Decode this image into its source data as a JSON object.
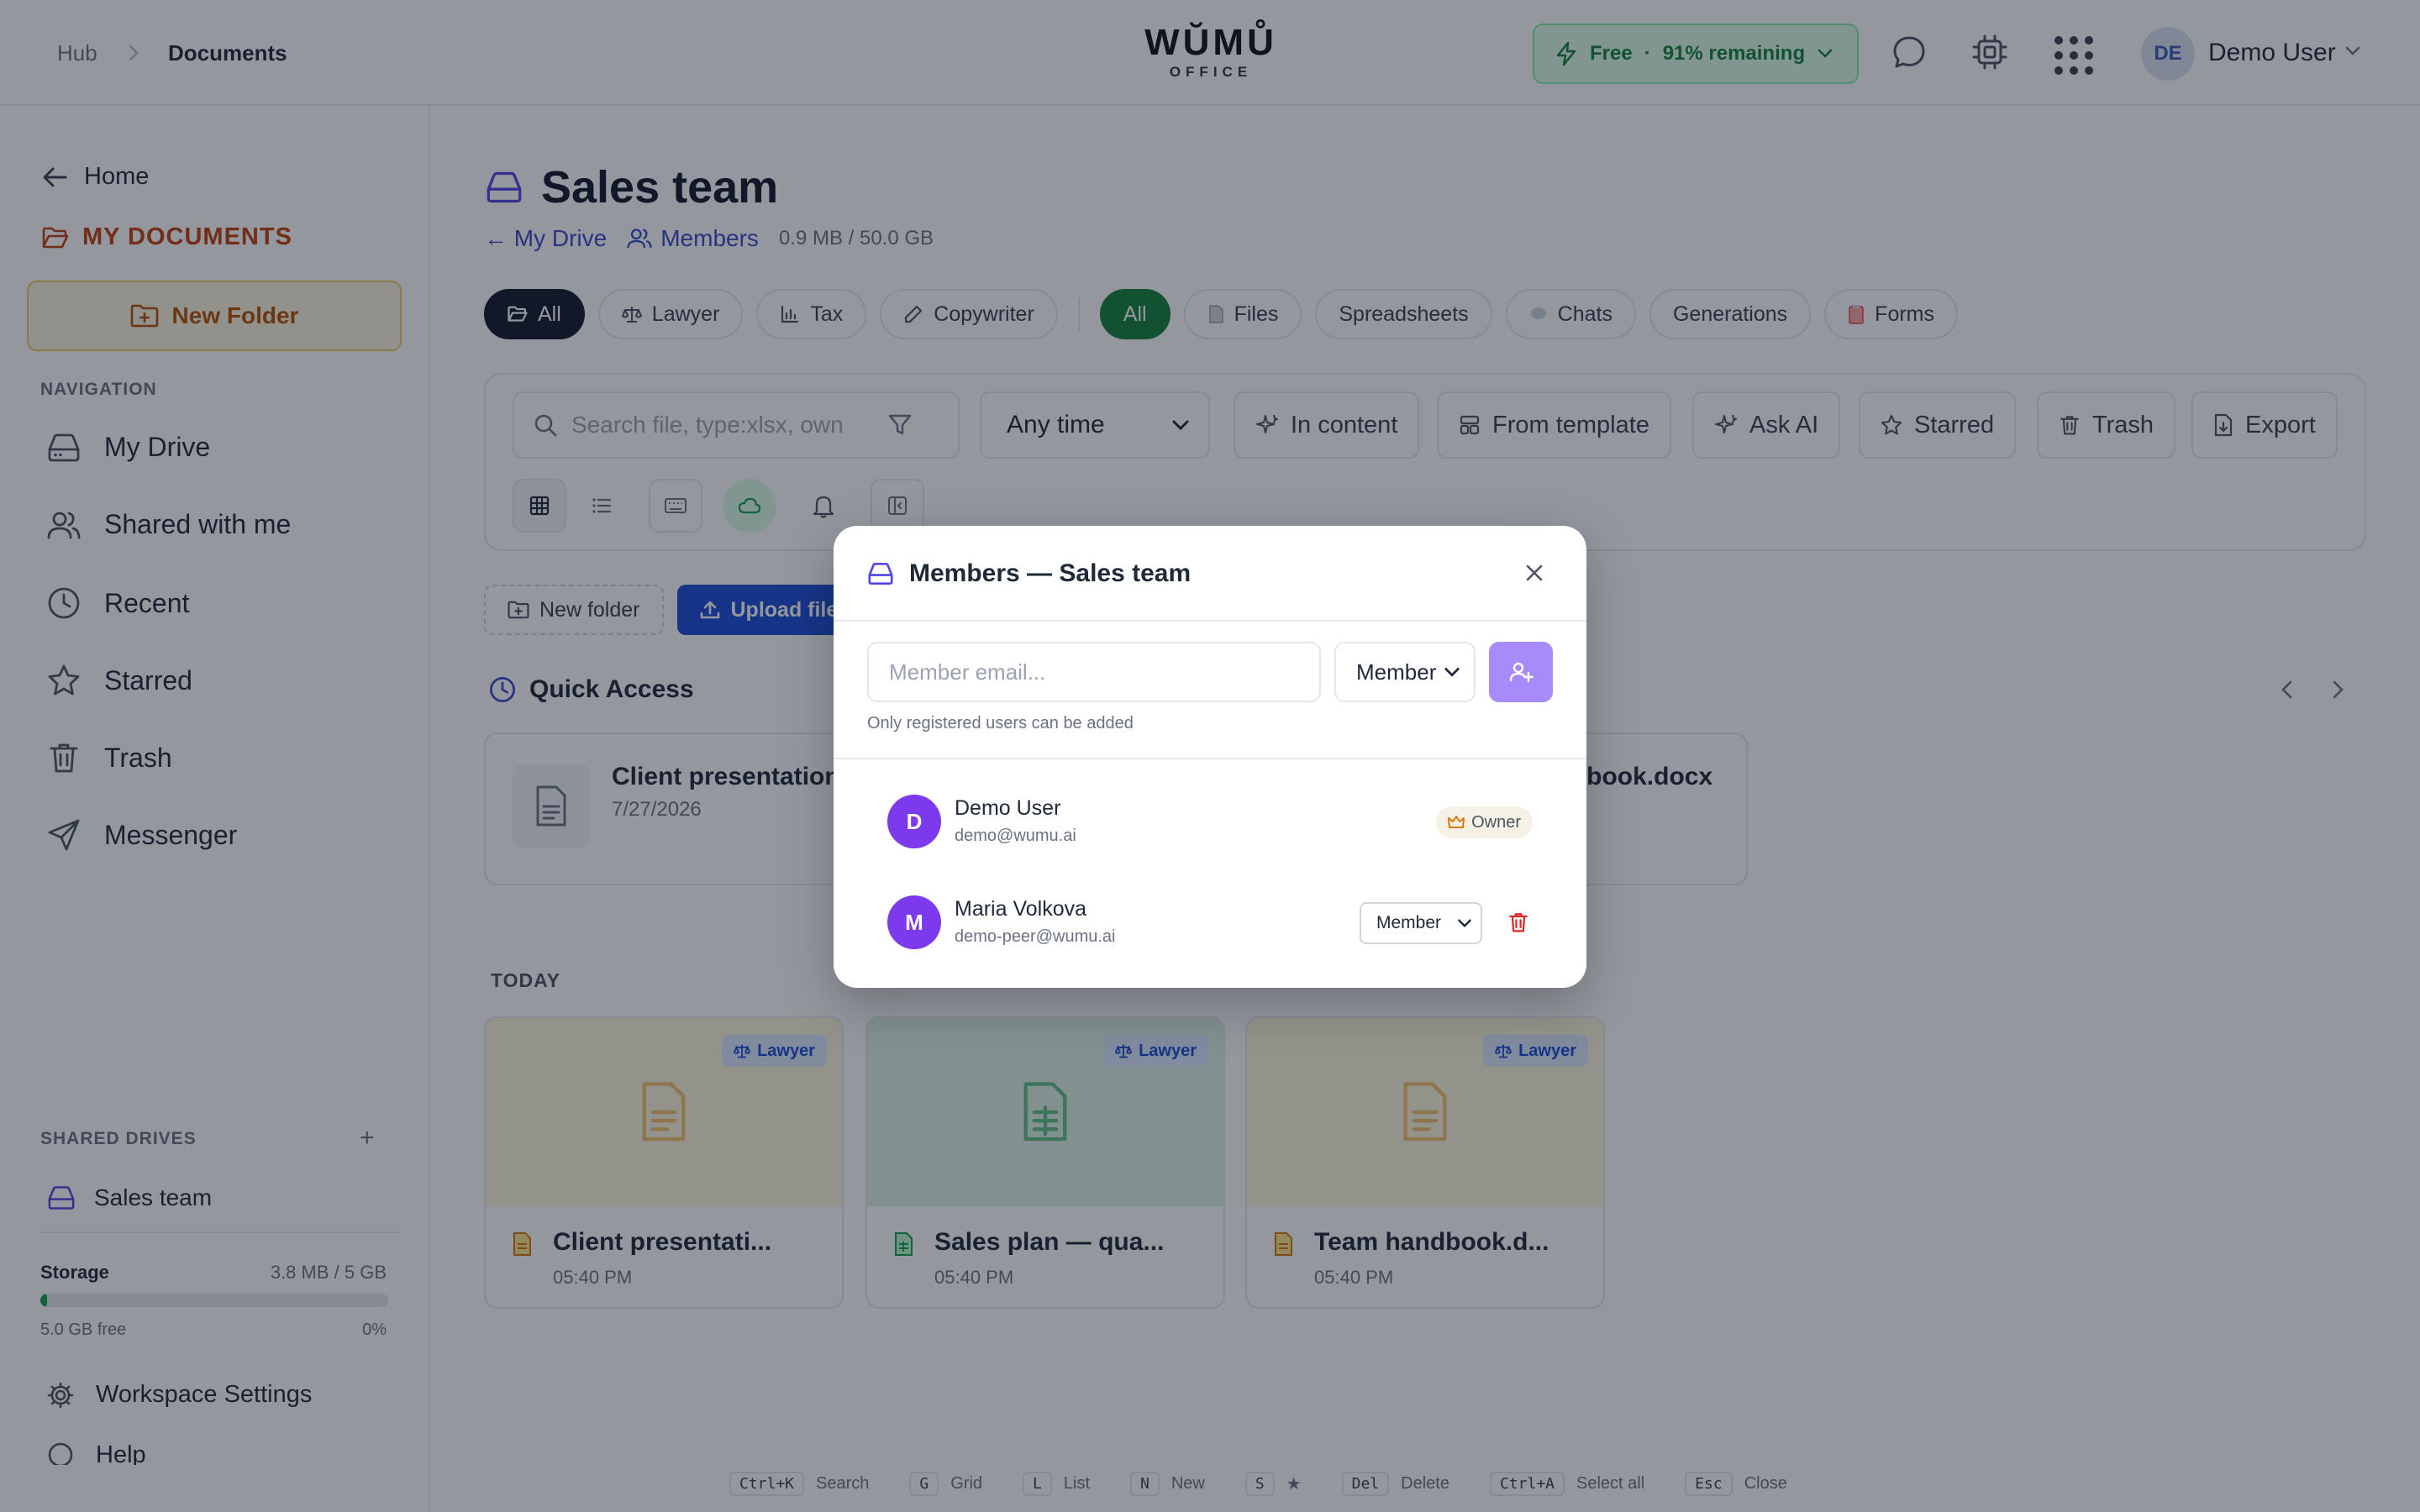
{
  "header": {
    "breadcrumb": [
      "Hub",
      "Documents"
    ],
    "logo_main": "WŬMŮ",
    "logo_sub": "OFFICE",
    "plan_label": "Free",
    "plan_remaining": "91% remaining",
    "user_initials": "DE",
    "user_name": "Demo User"
  },
  "sidebar": {
    "home": "Home",
    "my_documents": "MY DOCUMENTS",
    "new_folder": "New Folder",
    "nav_title": "NAVIGATION",
    "nav_items": [
      "My Drive",
      "Shared with me",
      "Recent",
      "Starred",
      "Trash",
      "Messenger"
    ],
    "shared_title": "SHARED DRIVES",
    "shared_items": [
      "Sales team"
    ],
    "storage_label": "Storage",
    "storage_value": "3.8 MB / 5 GB",
    "storage_fraction": 0.0,
    "storage_free": "5.0 GB free",
    "storage_pct": "0%",
    "workspace_settings": "Workspace Settings",
    "help": "Help"
  },
  "main": {
    "title": "Sales team",
    "back_link": "← My Drive",
    "members_link": "Members",
    "size": "0.9 MB / 50.0 GB",
    "role_chips": [
      "All",
      "Lawyer",
      "Tax",
      "Copywriter"
    ],
    "type_chips": [
      "All",
      "Files",
      "Spreadsheets",
      "Chats",
      "Generations",
      "Forms"
    ],
    "search_placeholder": "Search file, type:xlsx, own",
    "time_filter": "Any time",
    "toolbar_buttons": [
      "In content",
      "From template",
      "Ask AI",
      "Starred",
      "Trash",
      "Export"
    ],
    "new_folder": "New folder",
    "upload": "Upload files",
    "quick_access": "Quick Access",
    "quick_items": [
      {
        "name": "Client presentation.docx",
        "date": "7/27/2026"
      },
      {
        "name": "Team handbook.docx",
        "date": ""
      }
    ],
    "today_label": "TODAY",
    "files": [
      {
        "name": "Client presentati...",
        "time": "05:40 PM",
        "badge": "Lawyer"
      },
      {
        "name": "Sales plan — qua...",
        "time": "05:40 PM",
        "badge": "Lawyer"
      },
      {
        "name": "Team handbook.d...",
        "time": "05:40 PM",
        "badge": "Lawyer"
      }
    ]
  },
  "shortcuts": [
    {
      "key": "Ctrl+K",
      "label": "Search"
    },
    {
      "key": "G",
      "label": "Grid"
    },
    {
      "key": "L",
      "label": "List"
    },
    {
      "key": "N",
      "label": "New"
    },
    {
      "key": "S",
      "label": "★"
    },
    {
      "key": "Del",
      "label": "Delete"
    },
    {
      "key": "Ctrl+A",
      "label": "Select all"
    },
    {
      "key": "Esc",
      "label": "Close"
    }
  ],
  "modal": {
    "title": "Members — Sales team",
    "email_placeholder": "Member email...",
    "role_value": "Member",
    "hint": "Only registered users can be added",
    "members": [
      {
        "initial": "D",
        "name": "Demo User",
        "email": "demo@wumu.ai",
        "role": "Owner"
      },
      {
        "initial": "M",
        "name": "Maria Volkova",
        "email": "demo-peer@wumu.ai",
        "role": "Member"
      }
    ]
  },
  "colors": {
    "accent": "#3b4bc8",
    "owner_orange": "#c2410c",
    "plan_green": "#15803d",
    "avatar_purple": "#7c3aed",
    "add_button": "#a78bfa",
    "danger": "#dc2626"
  }
}
